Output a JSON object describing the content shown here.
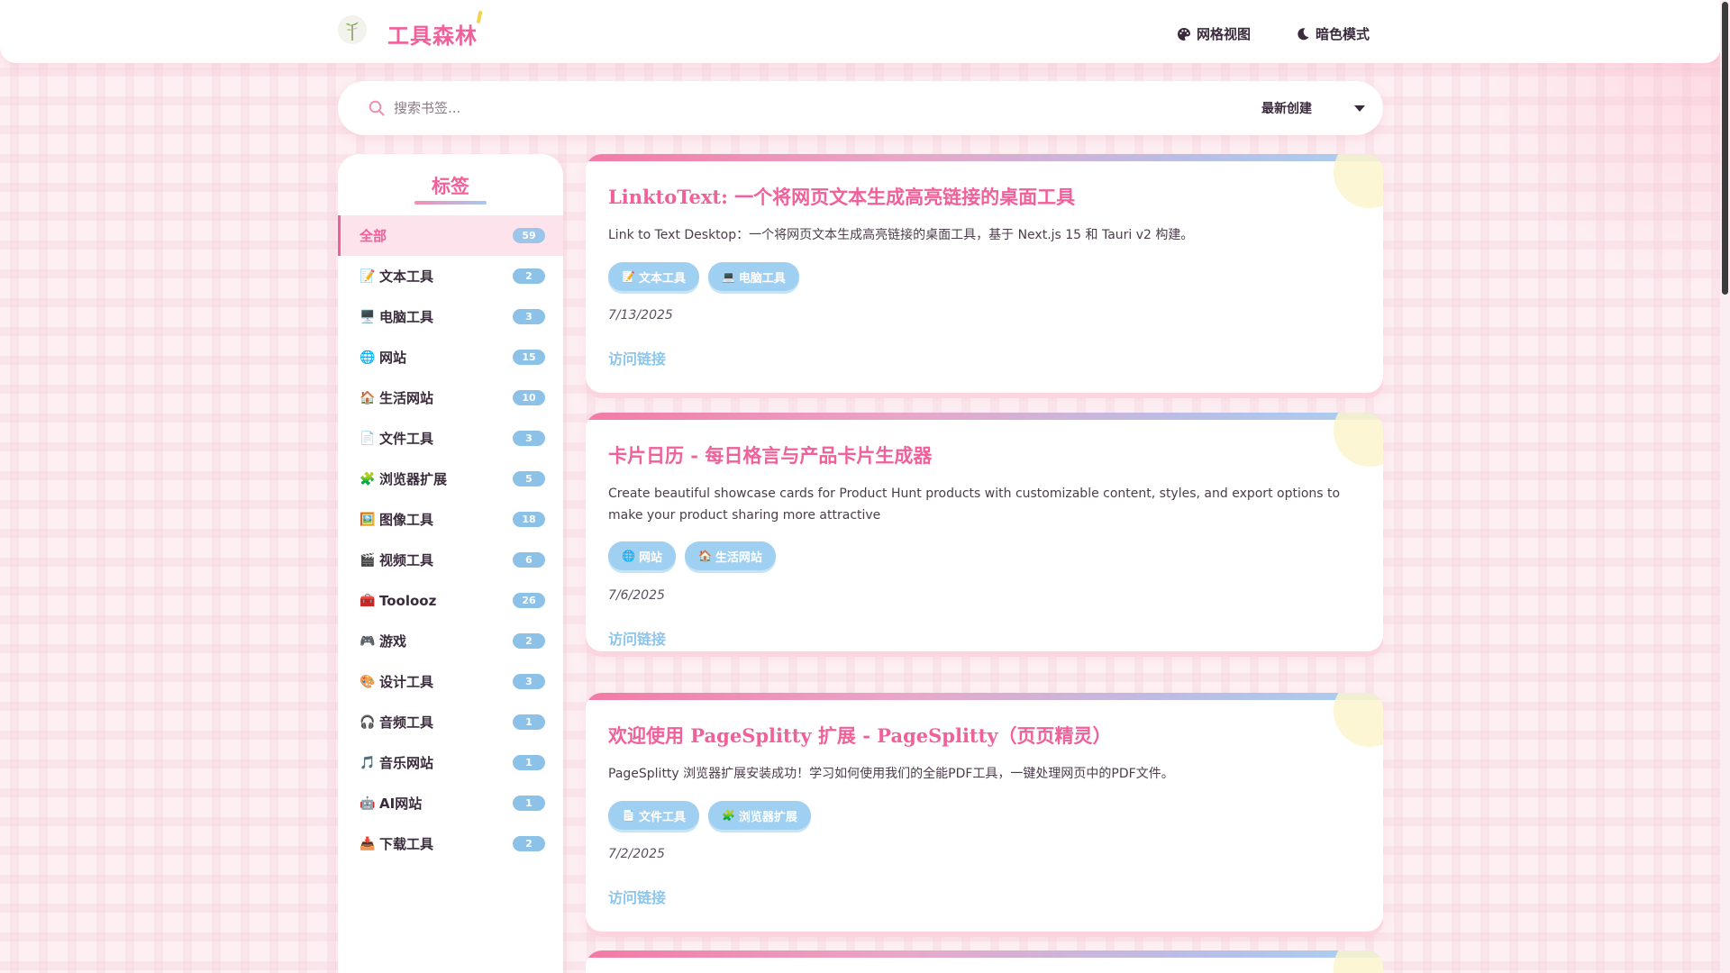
{
  "header": {
    "brand": "工具森林",
    "grid_view_label": "网格视图",
    "dark_mode_label": "暗色模式"
  },
  "search": {
    "placeholder": "搜索书签...",
    "sort_value": "最新创建"
  },
  "sidebar": {
    "title": "标签",
    "items": [
      {
        "emoji": "",
        "label": "全部",
        "count": "59",
        "active": true
      },
      {
        "emoji": "📝",
        "label": "文本工具",
        "count": "2"
      },
      {
        "emoji": "🖥️",
        "label": "电脑工具",
        "count": "3"
      },
      {
        "emoji": "🌐",
        "label": "网站",
        "count": "15"
      },
      {
        "emoji": "🏠",
        "label": "生活网站",
        "count": "10"
      },
      {
        "emoji": "📄",
        "label": "文件工具",
        "count": "3"
      },
      {
        "emoji": "🧩",
        "label": "浏览器扩展",
        "count": "5"
      },
      {
        "emoji": "🖼️",
        "label": "图像工具",
        "count": "18"
      },
      {
        "emoji": "🎬",
        "label": "视频工具",
        "count": "6"
      },
      {
        "emoji": "🧰",
        "label": "Toolooz",
        "count": "26"
      },
      {
        "emoji": "🎮",
        "label": "游戏",
        "count": "2"
      },
      {
        "emoji": "🎨",
        "label": "设计工具",
        "count": "3"
      },
      {
        "emoji": "🎧",
        "label": "音频工具",
        "count": "1"
      },
      {
        "emoji": "🎵",
        "label": "音乐网站",
        "count": "1"
      },
      {
        "emoji": "🤖",
        "label": "AI网站",
        "count": "1"
      },
      {
        "emoji": "📥",
        "label": "下载工具",
        "count": "2"
      }
    ]
  },
  "cards": [
    {
      "title": "LinktoText: 一个将网页文本生成高亮链接的桌面工具",
      "description": "Link to Text Desktop：一个将网页文本生成高亮链接的桌面工具，基于 Next.js 15 和 Tauri v2 构建。",
      "tags": [
        {
          "emoji": "📝",
          "label": "文本工具"
        },
        {
          "emoji": "💻",
          "label": "电脑工具"
        }
      ],
      "date": "7/13/2025",
      "link_label": "访问链接"
    },
    {
      "title": "卡片日历 - 每日格言与产品卡片生成器",
      "description": "Create beautiful showcase cards for Product Hunt products with customizable content, styles, and export options to make your product sharing more attractive",
      "tags": [
        {
          "emoji": "🌐",
          "label": "网站"
        },
        {
          "emoji": "🏠",
          "label": "生活网站"
        }
      ],
      "date": "7/6/2025",
      "link_label": "访问链接"
    },
    {
      "title": "欢迎使用 PageSplitty 扩展 - PageSplitty（页页精灵）",
      "description": "PageSplitty 浏览器扩展安装成功！学习如何使用我们的全能PDF工具，一键处理网页中的PDF文件。",
      "tags": [
        {
          "emoji": "📄",
          "label": "文件工具"
        },
        {
          "emoji": "🧩",
          "label": "浏览器扩展"
        }
      ],
      "date": "7/2/2025",
      "link_label": "访问链接"
    }
  ],
  "colors": {
    "accent_pink": "#f0609a",
    "chip_blue": "#9fd0f1",
    "background": "#fdeff3"
  }
}
